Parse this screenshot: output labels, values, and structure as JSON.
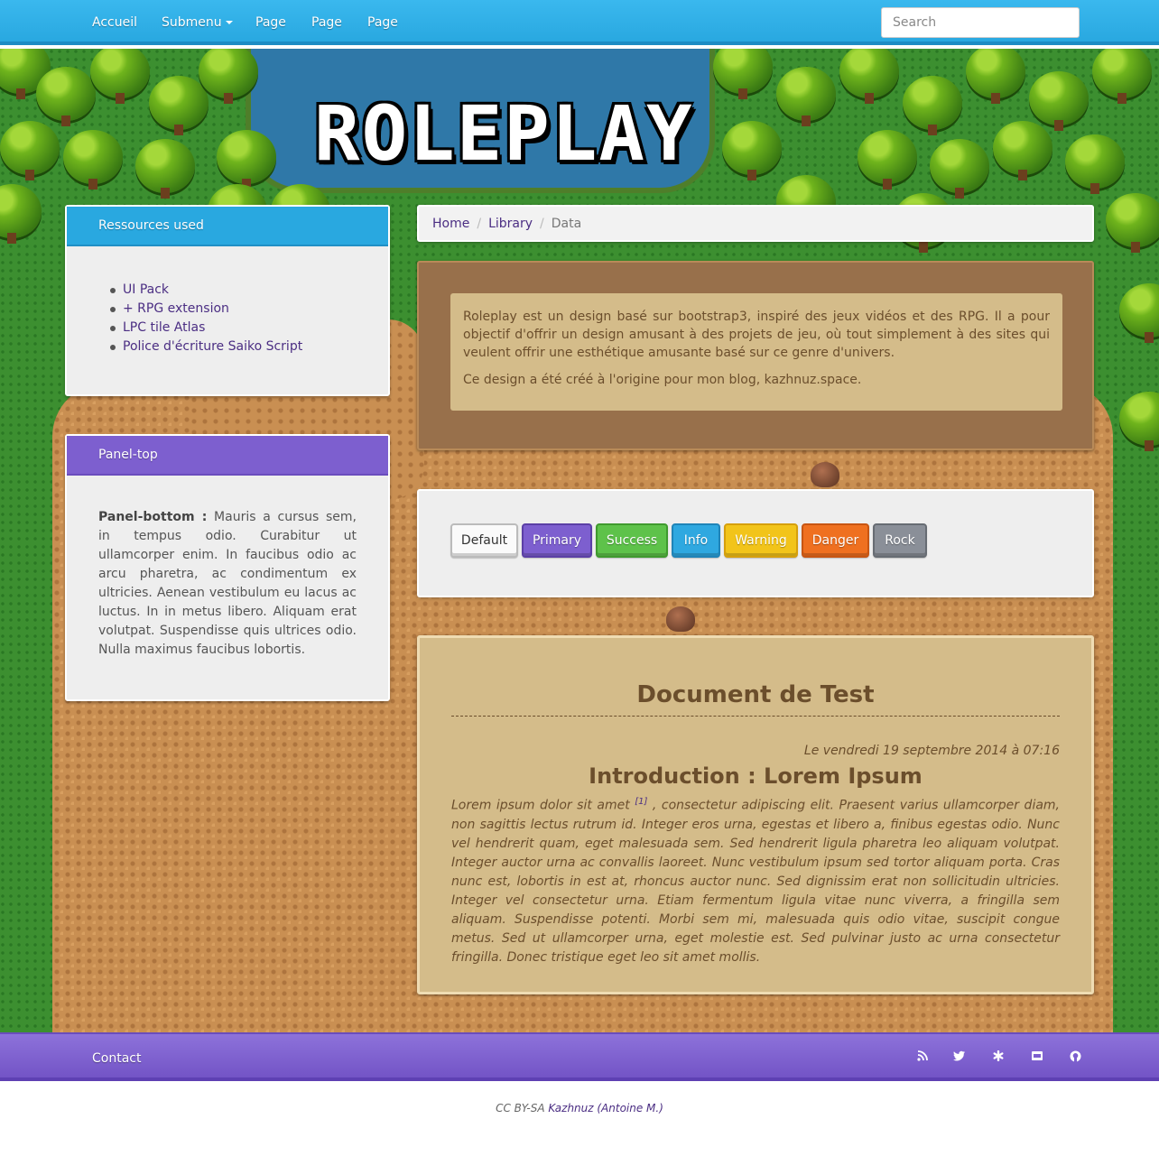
{
  "navbar": {
    "items": [
      {
        "label": "Accueil"
      },
      {
        "label": "Submenu"
      },
      {
        "label": "Page"
      },
      {
        "label": "Page"
      },
      {
        "label": "Page"
      }
    ],
    "search_placeholder": "Search"
  },
  "header": {
    "logo_text": "ROLEPLAY"
  },
  "sidebar": {
    "resources_panel": {
      "title": "Ressources used",
      "links": [
        "UI Pack",
        "+ RPG extension",
        "LPC tile Atlas",
        "Police d'écriture Saiko Script"
      ]
    },
    "top_panel": {
      "title": "Panel-top",
      "bold_label": "Panel-bottom :",
      "text": " Mauris a cursus sem, in tempus odio. Curabitur ut ullamcorper enim. In faucibus odio ac arcu pharetra, ac condimentum ex ultricies. Aenean vestibulum eu lacus ac luctus. In in metus libero. Aliquam erat volutpat. Suspendisse quis ultrices odio. Nulla maximus faucibus lobortis."
    }
  },
  "breadcrumb": {
    "home": "Home",
    "library": "Library",
    "active": "Data"
  },
  "intro": {
    "p1": "Roleplay est un design basé sur bootstrap3, inspiré des jeux vidéos et des RPG. Il a pour objectif d'offrir un design amusant à des projets de jeu, où tout simplement à des sites qui veulent offrir une esthétique amusante basé sur ce genre d'univers.",
    "p2": "Ce design a été créé à l'origine pour mon blog, kazhnuz.space."
  },
  "buttons": [
    "Default",
    "Primary",
    "Success",
    "Info",
    "Warning",
    "Danger",
    "Rock"
  ],
  "document": {
    "title": "Document de Test",
    "date": "Le vendredi 19 septembre 2014 à 07:16",
    "subtitle": "Introduction : Lorem Ipsum",
    "lead": "Lorem ipsum dolor sit amet ",
    "footnote": "[1]",
    "body": " , consectetur adipiscing elit. Praesent varius ullamcorper diam, non sagittis lectus rutrum id. Integer eros urna, egestas et libero a, finibus egestas odio. Nunc vel hendrerit quam, eget malesuada sem. Sed hendrerit ligula pharetra leo aliquam volutpat. Integer auctor urna ac convallis laoreet. Nunc vestibulum ipsum sed tortor aliquam porta. Cras nunc est, lobortis in est at, rhoncus auctor nunc. Sed dignissim erat non sollicitudin ultricies. Integer vel consectetur urna. Etiam fermentum ligula vitae nunc viverra, a fringilla sem aliquam. Suspendisse potenti. Morbi sem mi, malesuada quis odio vitae, suscipit congue metus. Sed ut ullamcorper urna, eget molestie est. Sed pulvinar justo ac urna consectetur fringilla. Donec tristique eget leo sit amet mollis."
  },
  "footer": {
    "contact": "Contact",
    "icons": [
      "rss-icon",
      "twitter-icon",
      "asterisk-icon",
      "deviantart-icon",
      "github-icon"
    ],
    "credits_prefix": "CC BY-SA ",
    "credits_author": "Kazhnuz (Antoine M.)"
  },
  "colors": {
    "navbar": "#29a8e0",
    "footer": "#7d5fcf",
    "link": "#4b2e83",
    "parchment": "#d4bc8a",
    "wood": "#98704b"
  }
}
